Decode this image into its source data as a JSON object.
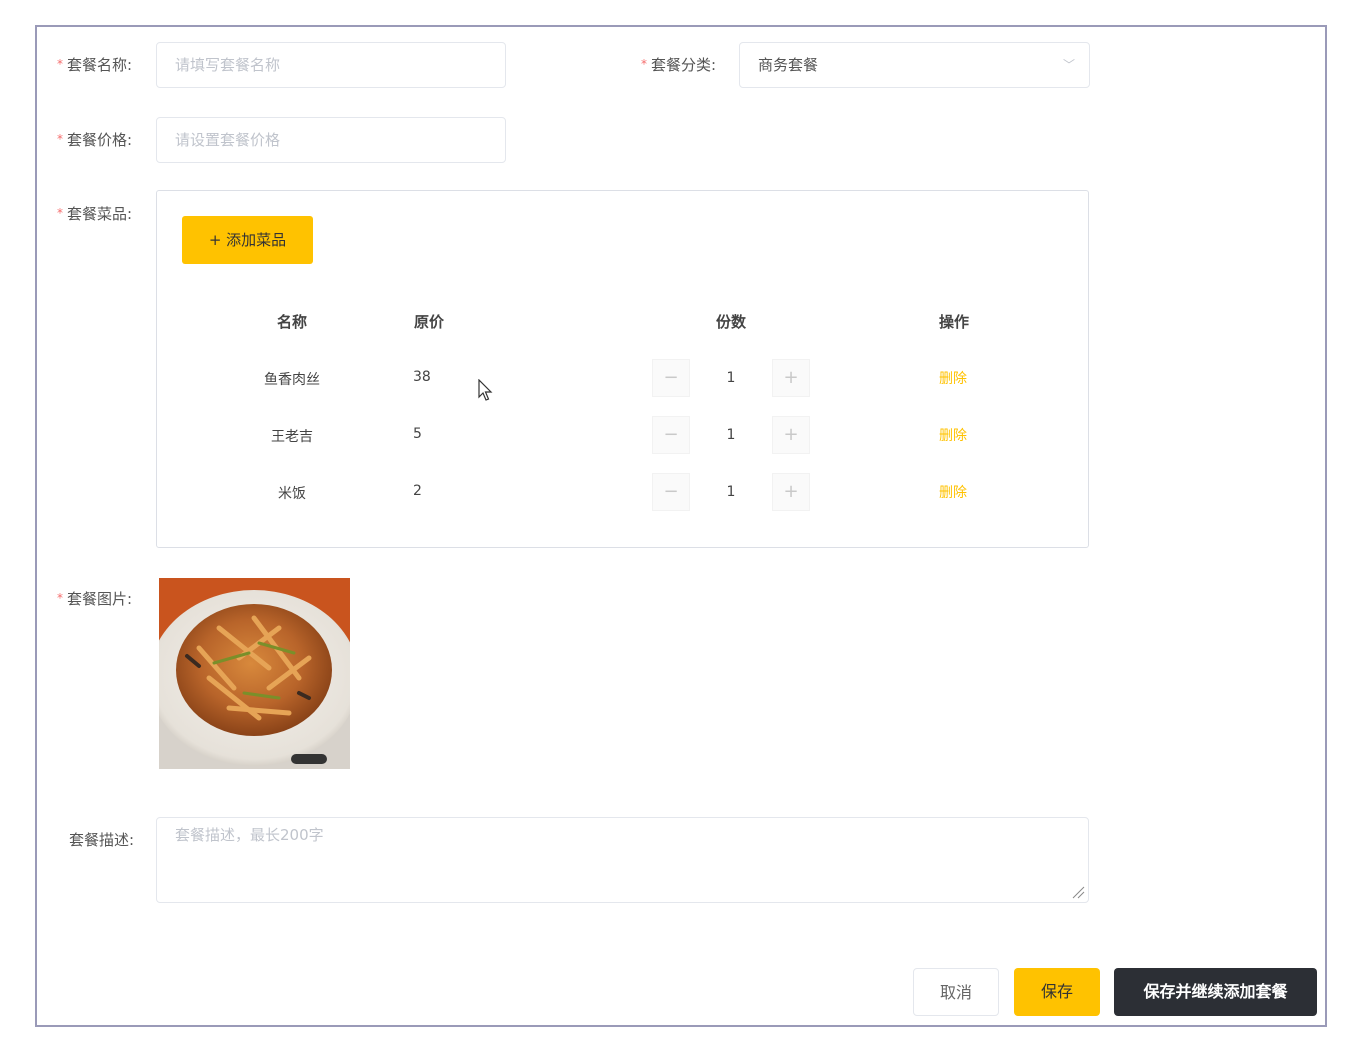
{
  "form": {
    "name": {
      "label": "套餐名称:",
      "placeholder": "请填写套餐名称",
      "value": ""
    },
    "category": {
      "label": "套餐分类:",
      "value": "商务套餐"
    },
    "price": {
      "label": "套餐价格:",
      "placeholder": "请设置套餐价格",
      "value": ""
    },
    "dishes": {
      "label": "套餐菜品:",
      "add_label": "+ 添加菜品",
      "columns": {
        "name": "名称",
        "price": "原价",
        "count": "份数",
        "action": "操作"
      },
      "rows": [
        {
          "name": "鱼香肉丝",
          "price": "38",
          "count": "1",
          "action": "删除"
        },
        {
          "name": "王老吉",
          "price": "5",
          "count": "1",
          "action": "删除"
        },
        {
          "name": "米饭",
          "price": "2",
          "count": "1",
          "action": "删除"
        }
      ]
    },
    "image": {
      "label": "套餐图片:"
    },
    "description": {
      "label": "套餐描述:",
      "placeholder": "套餐描述，最长200字",
      "value": ""
    }
  },
  "stepper": {
    "minus": "−",
    "plus": "+"
  },
  "actions": {
    "cancel": "取消",
    "save": "保存",
    "save_continue": "保存并继续添加套餐"
  },
  "required_mark": "*",
  "colors": {
    "accent": "#ffc200",
    "dark_button": "#2c2f35",
    "required": "#f56c6c"
  }
}
